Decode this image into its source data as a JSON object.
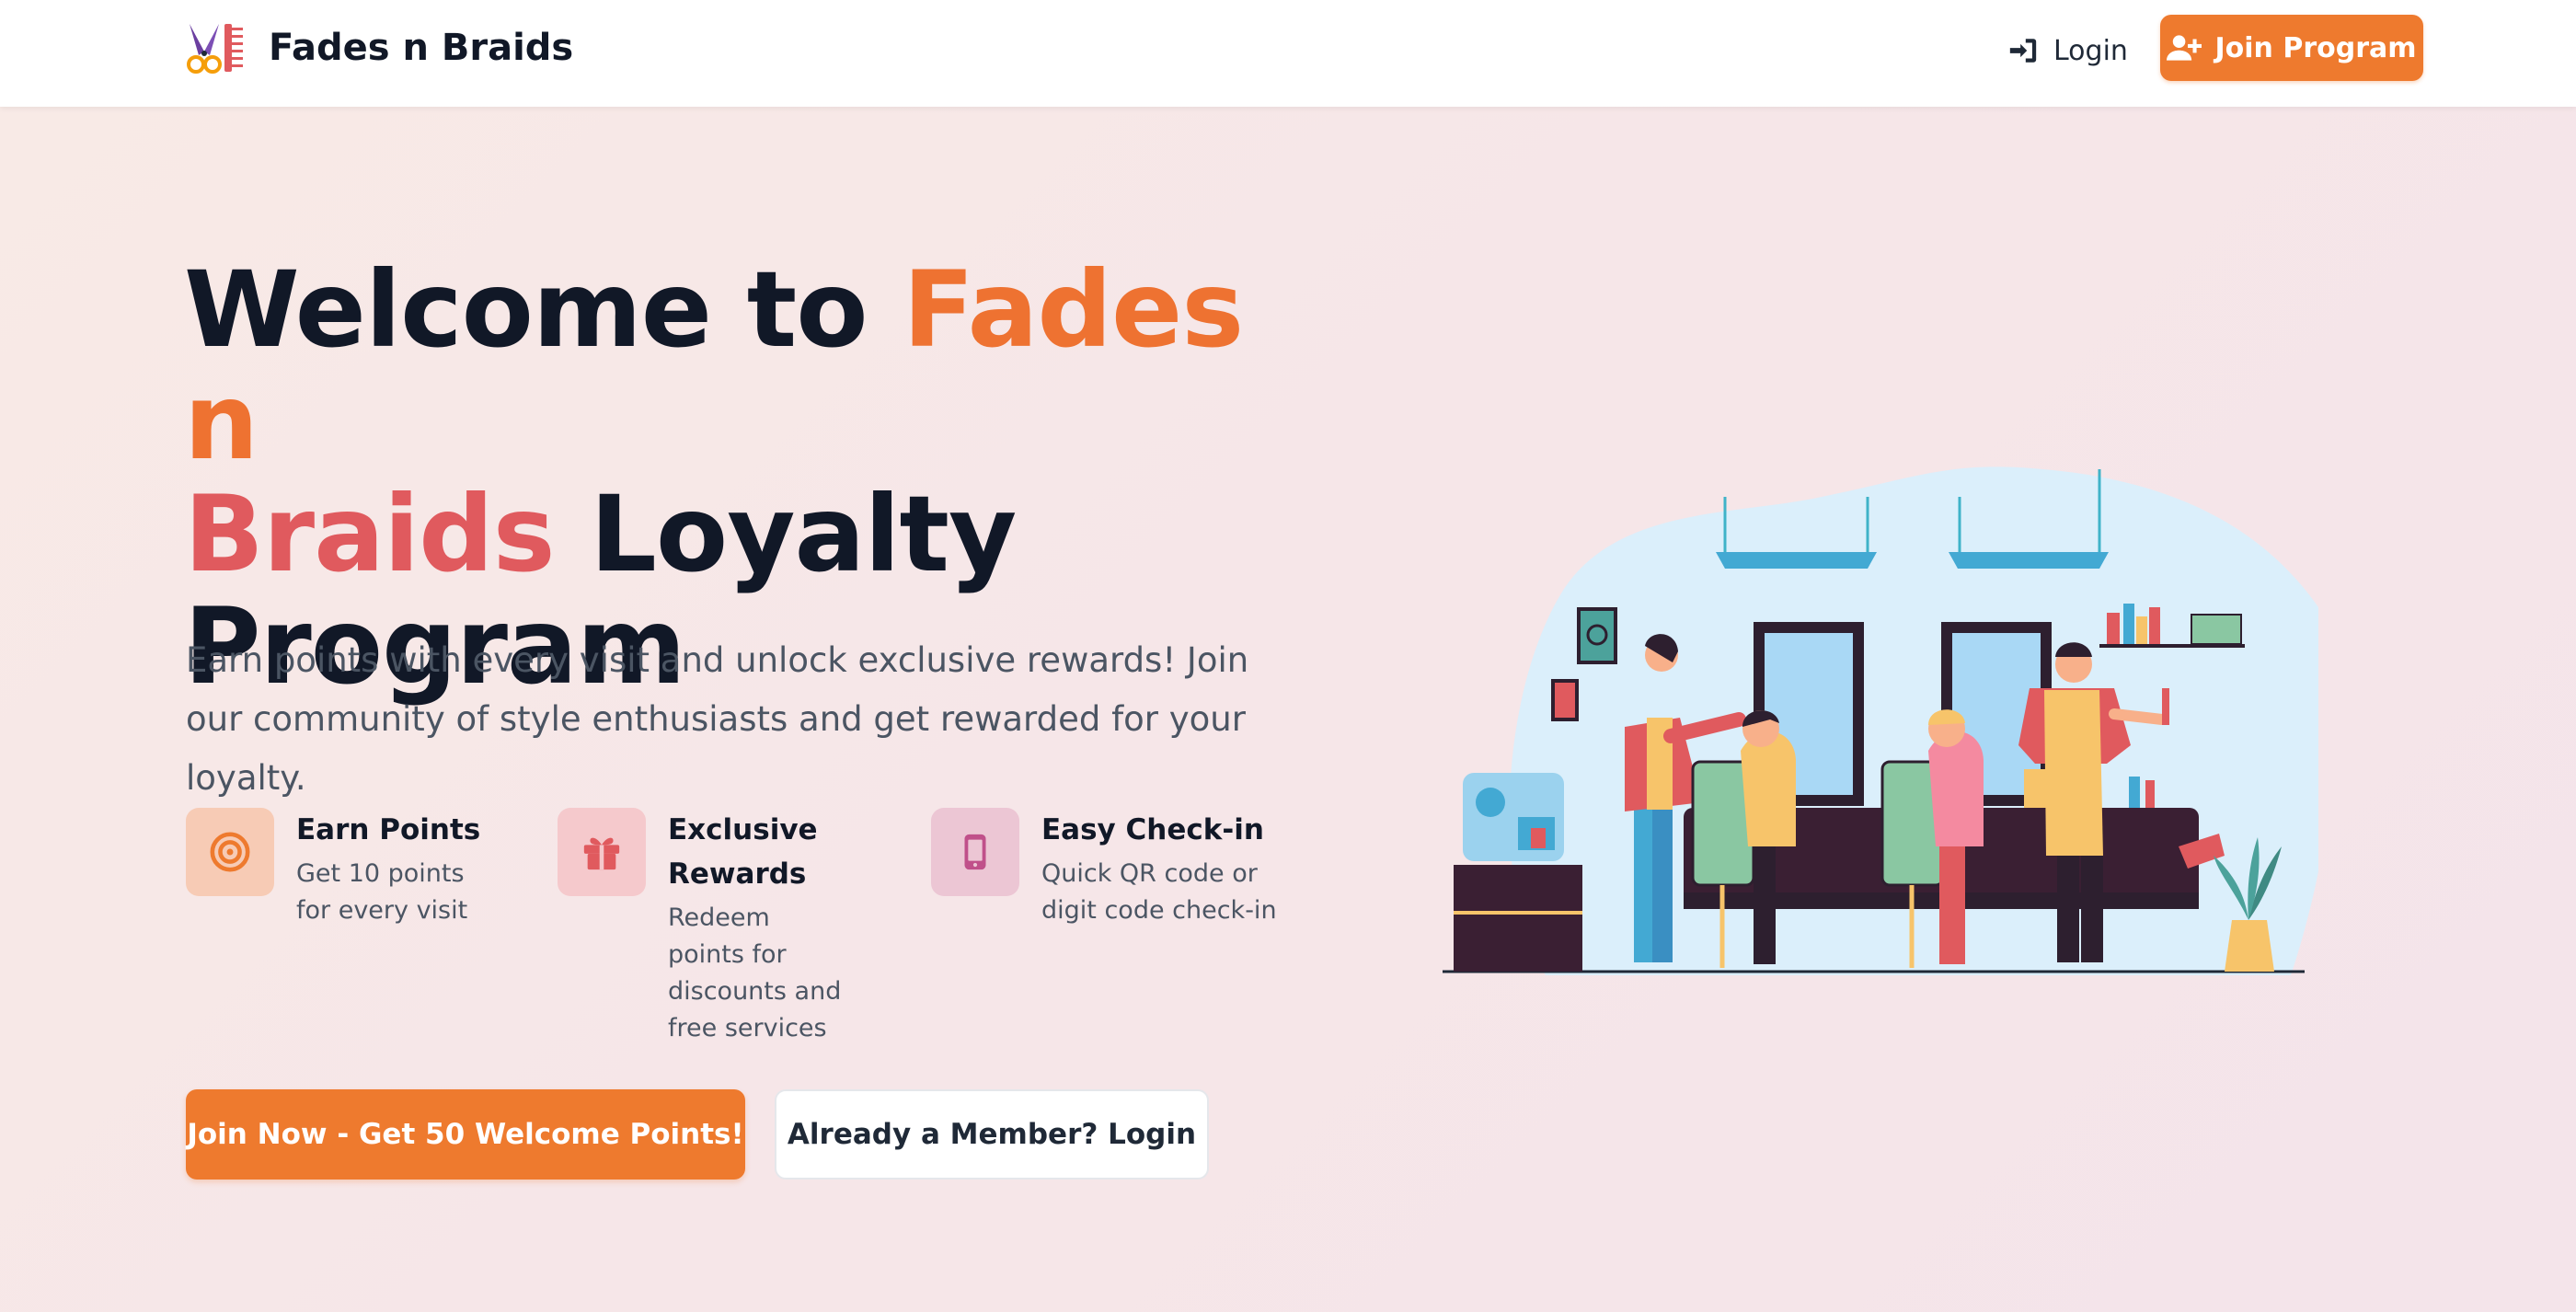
{
  "navbar": {
    "brand_name": "Fades n Braids",
    "login_label": "Login",
    "join_label": "Join Program"
  },
  "hero": {
    "title_part1": "Welcome to ",
    "title_highlight1": "Fades n ",
    "title_highlight2": "Braids",
    "title_part2": " Loyalty Program",
    "subtitle": "Earn points with every visit and unlock exclusive rewards! Join our community of style enthusiasts and get rewarded for your loyalty."
  },
  "features": [
    {
      "icon": "target-icon",
      "title": "Earn Points",
      "desc": "Get 10 points for every visit",
      "color": "#f7c9b3",
      "icon_color": "#ee7a2e"
    },
    {
      "icon": "gift-icon",
      "title": "Exclusive Rewards",
      "desc": "Redeem points for discounts and free services",
      "color": "#f5c8cb",
      "icon_color": "#e05a5e"
    },
    {
      "icon": "mobile-icon",
      "title": "Easy Check-in",
      "desc": "Quick QR code or digit code check-in",
      "color": "#ebc6d3",
      "icon_color": "#c0508a"
    }
  ],
  "cta": {
    "primary_label": "Join Now - Get 50 Welcome Points!",
    "secondary_label": "Already a Member? Login"
  },
  "colors": {
    "accent": "#ee7a2e",
    "highlight_red": "#e05a5e",
    "text_dark": "#111827",
    "text_muted": "#4b5563"
  }
}
